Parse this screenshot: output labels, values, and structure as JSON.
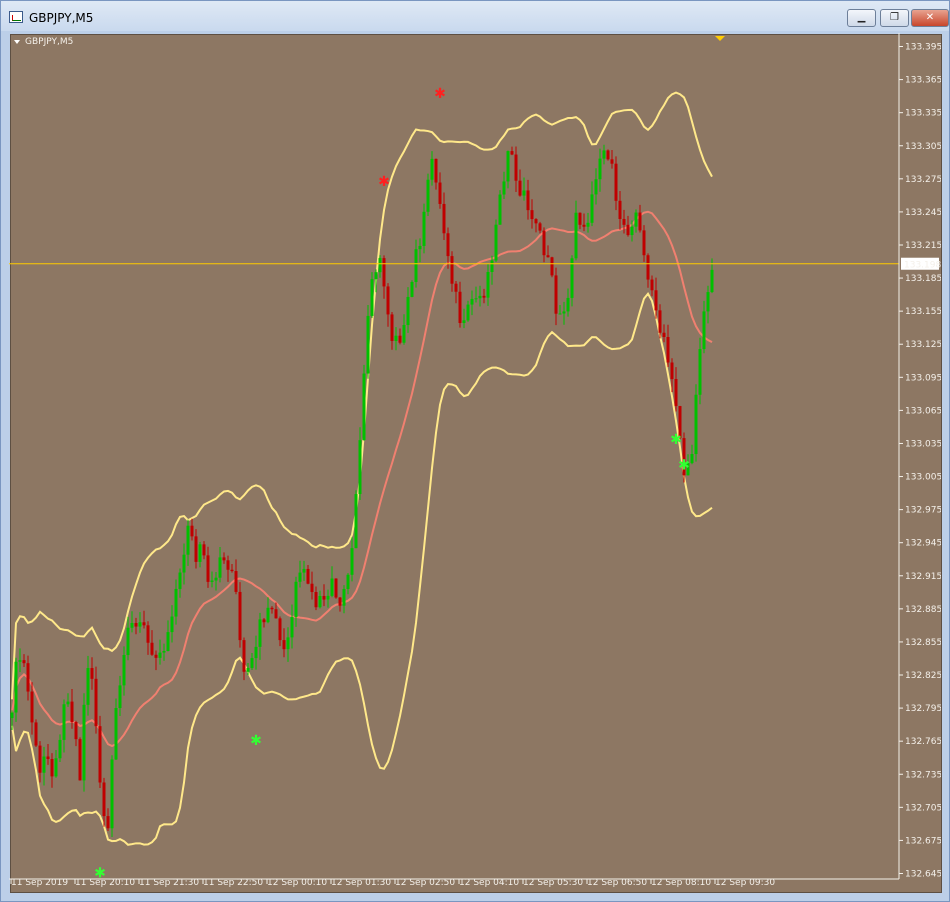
{
  "window": {
    "title": "GBPJPY,M5",
    "minimize_glyph": "▁",
    "restore_glyph": "❐",
    "close_glyph": "✕"
  },
  "chart_label": "GBPJPY,M5",
  "current_price_label": "133.198",
  "colors": {
    "background": "#8d7763",
    "bull_candle": "#00c000",
    "bear_candle": "#c00000",
    "band": "#ffe88a",
    "middle_band": "#f08070",
    "price_line": "#ffcc00",
    "buy_signal": "#33ff33",
    "sell_signal": "#ff2020"
  },
  "chart_data": {
    "type": "candlestick",
    "instrument": "GBPJPY",
    "timeframe": "M5",
    "ylim": [
      132.64,
      133.4
    ],
    "y_ticks": [
      "133.395",
      "133.365",
      "133.335",
      "133.305",
      "133.275",
      "133.245",
      "133.215",
      "133.185",
      "133.155",
      "133.125",
      "133.095",
      "133.065",
      "133.035",
      "133.005",
      "132.975",
      "132.945",
      "132.915",
      "132.885",
      "132.855",
      "132.825",
      "132.795",
      "132.765",
      "132.735",
      "132.705",
      "132.675",
      "132.645"
    ],
    "x_labels": [
      "11 Sep 2019",
      "11 Sep 20:10",
      "11 Sep 21:30",
      "11 Sep 22:50",
      "12 Sep 00:10",
      "12 Sep 01:30",
      "12 Sep 02:50",
      "12 Sep 04:10",
      "12 Sep 05:30",
      "12 Sep 06:50",
      "12 Sep 08:10",
      "12 Sep 09:30"
    ],
    "current_price": 133.198,
    "close_path": [
      132.8,
      132.85,
      132.83,
      132.78,
      132.74,
      132.76,
      132.72,
      132.77,
      132.8,
      132.78,
      132.73,
      132.84,
      132.81,
      132.72,
      132.68,
      132.78,
      132.83,
      132.87,
      132.86,
      132.88,
      132.86,
      132.83,
      132.84,
      132.86,
      132.89,
      132.93,
      132.96,
      132.93,
      132.95,
      132.91,
      132.92,
      132.93,
      132.92,
      132.9,
      132.83,
      132.84,
      132.86,
      132.88,
      132.9,
      132.87,
      132.85,
      132.87,
      132.92,
      132.93,
      132.9,
      132.89,
      132.9,
      132.91,
      132.89,
      132.91,
      132.94,
      133.02,
      133.12,
      133.18,
      133.21,
      133.16,
      133.12,
      133.13,
      133.16,
      133.19,
      133.22,
      133.27,
      133.29,
      133.25,
      133.2,
      133.18,
      133.15,
      133.16,
      133.17,
      133.16,
      133.18,
      133.22,
      133.26,
      133.31,
      133.28,
      133.26,
      133.25,
      133.23,
      133.22,
      133.2,
      133.16,
      133.14,
      133.18,
      133.24,
      133.22,
      133.25,
      133.27,
      133.3,
      133.29,
      133.26,
      133.23,
      133.22,
      133.24,
      133.21,
      133.17,
      133.15,
      133.13,
      133.1,
      133.05,
      133.0,
      133.03,
      133.1,
      133.16,
      133.19
    ]
  },
  "signals": [
    {
      "type": "buy",
      "time_index": 13,
      "price": 132.645
    },
    {
      "type": "buy",
      "time_index": 36,
      "price": 132.765
    },
    {
      "type": "sell",
      "time_index": 55,
      "price": 133.272
    },
    {
      "type": "sell",
      "time_index": 63,
      "price": 133.352
    },
    {
      "type": "buy",
      "time_index": 98,
      "price": 133.038
    },
    {
      "type": "buy",
      "time_index": 99,
      "price": 133.015
    }
  ]
}
